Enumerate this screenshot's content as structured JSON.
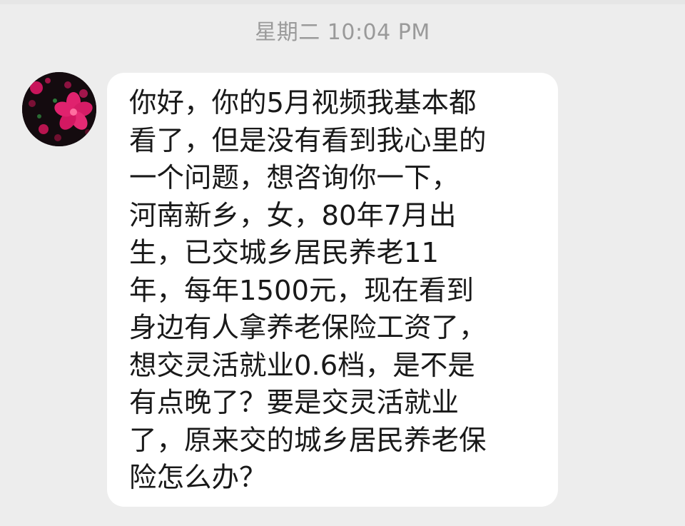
{
  "chat": {
    "timestamp": "星期二 10:04 PM",
    "avatar_icon": "flower-avatar-icon",
    "message": {
      "text": "你好，你的5月视频我基本都\n看了，但是没有看到我心里的\n一个问题，想咨询你一下，\n河南新乡，女，80年7月出\n生，已交城乡居民养老11\n年，每年1500元，现在看到\n身边有人拿养老保险工资了，\n想交灵活就业0.6档，是不是\n有点晚了？要是交灵活就业\n了，原来交的城乡居民养老保\n险怎么办？"
    }
  },
  "colors": {
    "background": "#ededed",
    "bubble": "#ffffff",
    "text": "#191919",
    "timestamp": "#9a9a9a"
  }
}
